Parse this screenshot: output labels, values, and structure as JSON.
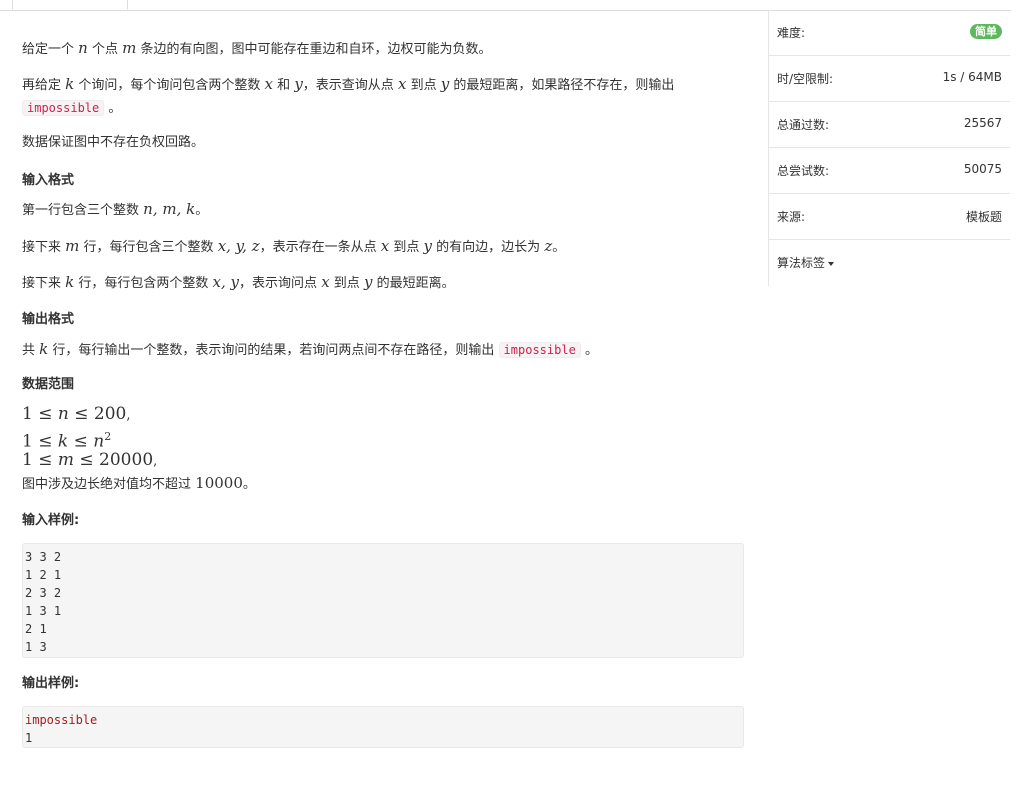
{
  "problem": {
    "desc1": {
      "a": "给定一个",
      "n": "n",
      "b": "个点",
      "m": "m",
      "c": "条边的有向图，图中可能存在重边和自环，边权可能为负数。"
    },
    "desc2": {
      "a": "再给定",
      "k": "k",
      "b": "个询问，每个询问包含两个整数",
      "x": "x",
      "c": "和",
      "y": "y",
      "d": "，表示查询从点",
      "x2": "x",
      "e": "到点",
      "y2": "y",
      "f": "的最短距离，如果路径不存在，则输出",
      "code": "impossible",
      "g": "。"
    },
    "desc3": "数据保证图中不存在负权回路。",
    "input_format_title": "输入格式",
    "in1": {
      "a": "第一行包含三个整数",
      "nmk": "n, m, k",
      "b": "。"
    },
    "in2": {
      "a": "接下来",
      "m": "m",
      "b": "行，每行包含三个整数",
      "xyz": "x, y, z",
      "c": "，表示存在一条从点",
      "x": "x",
      "d": "到点",
      "y": "y",
      "e": "的有向边，边长为",
      "z": "z",
      "f": "。"
    },
    "in3": {
      "a": "接下来",
      "k": "k",
      "b": "行，每行包含两个整数",
      "xy": "x, y",
      "c": "，表示询问点",
      "x": "x",
      "d": "到点",
      "y": "y",
      "e": "的最短距离。"
    },
    "output_format_title": "输出格式",
    "out1": {
      "a": "共",
      "k": "k",
      "b": "行，每行输出一个整数，表示询问的结果，若询问两点间不存在路径，则输出",
      "code": "impossible",
      "c": "。"
    },
    "range_title": "数据范围",
    "range": {
      "r1": {
        "a": "1 ≤ ",
        "v": "n",
        "b": " ≤ 200",
        "c": ","
      },
      "r2": {
        "a": "1 ≤ ",
        "v": "k",
        "b": " ≤ ",
        "v2": "n",
        "sup": "2"
      },
      "r3": {
        "a": "1 ≤ ",
        "v": "m",
        "b": " ≤ 20000",
        "c": ","
      },
      "r4": {
        "a": "图中涉及边长绝对值均不超过",
        "num": "10000",
        "b": "。"
      }
    },
    "sample_input_title": "输入样例:",
    "sample_input": [
      "3 3 2",
      "1 2 1",
      "2 3 2",
      "1 3 1",
      "2 1",
      "1 3"
    ],
    "sample_output_title": "输出样例:",
    "sample_output": [
      "impossible",
      "1"
    ]
  },
  "panel": {
    "difficulty_label": "难度:",
    "difficulty_value": "简单",
    "limit_label": "时/空限制:",
    "limit_value": "1s / 64MB",
    "passed_label": "总通过数:",
    "passed_value": "25567",
    "tried_label": "总尝试数:",
    "tried_value": "50075",
    "source_label": "来源:",
    "source_value": "模板题",
    "tags_label": "算法标签"
  },
  "colors": {
    "badge": "#5cb85c",
    "code_text": "#c7254e",
    "code_bg": "#f9f2f4"
  }
}
